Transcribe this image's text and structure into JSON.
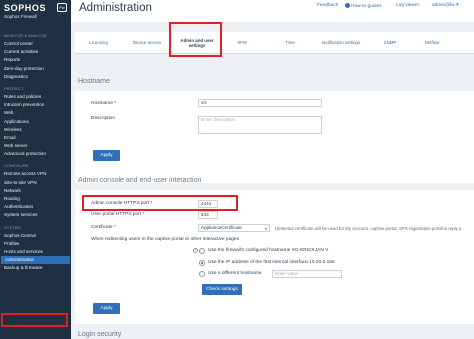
{
  "logo": {
    "brand": "SOPHOS",
    "product": "Sophos Firewall",
    "badge": "Fw"
  },
  "sidebar": {
    "sections": [
      {
        "title": "MONITOR & ANALYZE",
        "items": [
          "Control center",
          "Current activities",
          "Reports",
          "Zero-day protection",
          "Diagnostics"
        ]
      },
      {
        "title": "PROTECT",
        "items": [
          "Rules and policies",
          "Intrusion prevention",
          "Web",
          "Applications",
          "Wireless",
          "Email",
          "Web server",
          "Advanced protection"
        ]
      },
      {
        "title": "CONFIGURE",
        "items": [
          "Remote access VPN",
          "Site-to-site VPN",
          "Network",
          "Routing",
          "Authentication",
          "System services"
        ]
      },
      {
        "title": "SYSTEM",
        "items": [
          "Sophos Central",
          "Profiles",
          "Hosts and services",
          "Administration",
          "Backup & firmware"
        ]
      }
    ],
    "active": "Administration"
  },
  "header": {
    "title": "Administration",
    "links": {
      "feedback": "Feedback",
      "howto": "How-to guides",
      "logviewer": "Log viewer",
      "user": "admin@fw"
    }
  },
  "tabs": [
    "Licensing",
    "Device access",
    "Admin and user settings",
    "SFM",
    "Time",
    "Notification settings",
    "SNMP",
    "Netflow"
  ],
  "hostname": {
    "section_title": "Hostname",
    "hostname_label": "Hostname *",
    "hostname_value": "xG",
    "description_label": "Description",
    "description_placeholder": "Enter description",
    "apply": "Apply"
  },
  "admin_console": {
    "section_title": "Admin console and end-user interaction",
    "https_label": "Admin console HTTPS port *",
    "https_value": "4444",
    "user_port_label": "User portal HTTPS port *",
    "user_port_value": "443",
    "certificate_label": "Certificate *",
    "certificate_value": "ApplianceCertificate",
    "certificate_note": "(Selected certificate will be used for My Account, captive portal, SPX registration portal & reply p",
    "redirect_label": "When redirecting users to the captive portal or other interactive pages",
    "options": [
      "Use the firewall's configured hostname  XG-ERICKJAN V",
      "Use the IP address of the first internal interface  10.20.0.156",
      "Use a different hostname"
    ],
    "alt_host_placeholder": "Enter value",
    "check_settings": "Check settings",
    "apply": "Apply"
  },
  "login_security": {
    "section_title": "Login security"
  }
}
